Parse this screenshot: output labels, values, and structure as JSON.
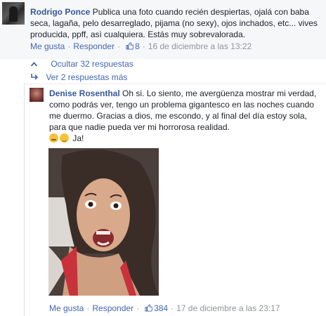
{
  "comment": {
    "author": "Rodrigo Ponce",
    "text": "Publica una foto cuando recién despiertas, ojalá con baba seca, lagaña, pelo desarreglado, pijama (no sexy), ojos inchados, etc... vives producida, ppff, asì cualquiera. Estás muy sobrevalorada.",
    "like_label": "Me gusta",
    "reply_label": "Responder",
    "likes": "8",
    "timestamp": "16 de diciembre a las 13:22"
  },
  "thread": {
    "hide_label": "Ocultar 32 respuestas",
    "more_label": "Ver 2 respuestas más"
  },
  "reply": {
    "author": "Denise Rosenthal",
    "text": "Oh si. Lo siento, me avergüenza mostrar mi verdad, como podrás ver, tengo un problema gigantesco en las noches cuando me duermo. Gracias a dios, me escondo, y al final del día estoy sola, para que nadie pueda ver mi horrorosa realidad.",
    "suffix": "Ja!",
    "like_label": "Me gusta",
    "reply_label": "Responder",
    "likes": "384",
    "timestamp": "17 de diciembre a las 23:17"
  },
  "colors": {
    "link": "#4267b2",
    "author": "#365899",
    "meta": "#90949c",
    "panel": "#f6f7f9"
  },
  "icons": [
    "thumbs-up-icon",
    "chevron-up-icon",
    "reply-arrow-icon",
    "sad-face-emoji-icon",
    "relieved-face-emoji-icon"
  ]
}
